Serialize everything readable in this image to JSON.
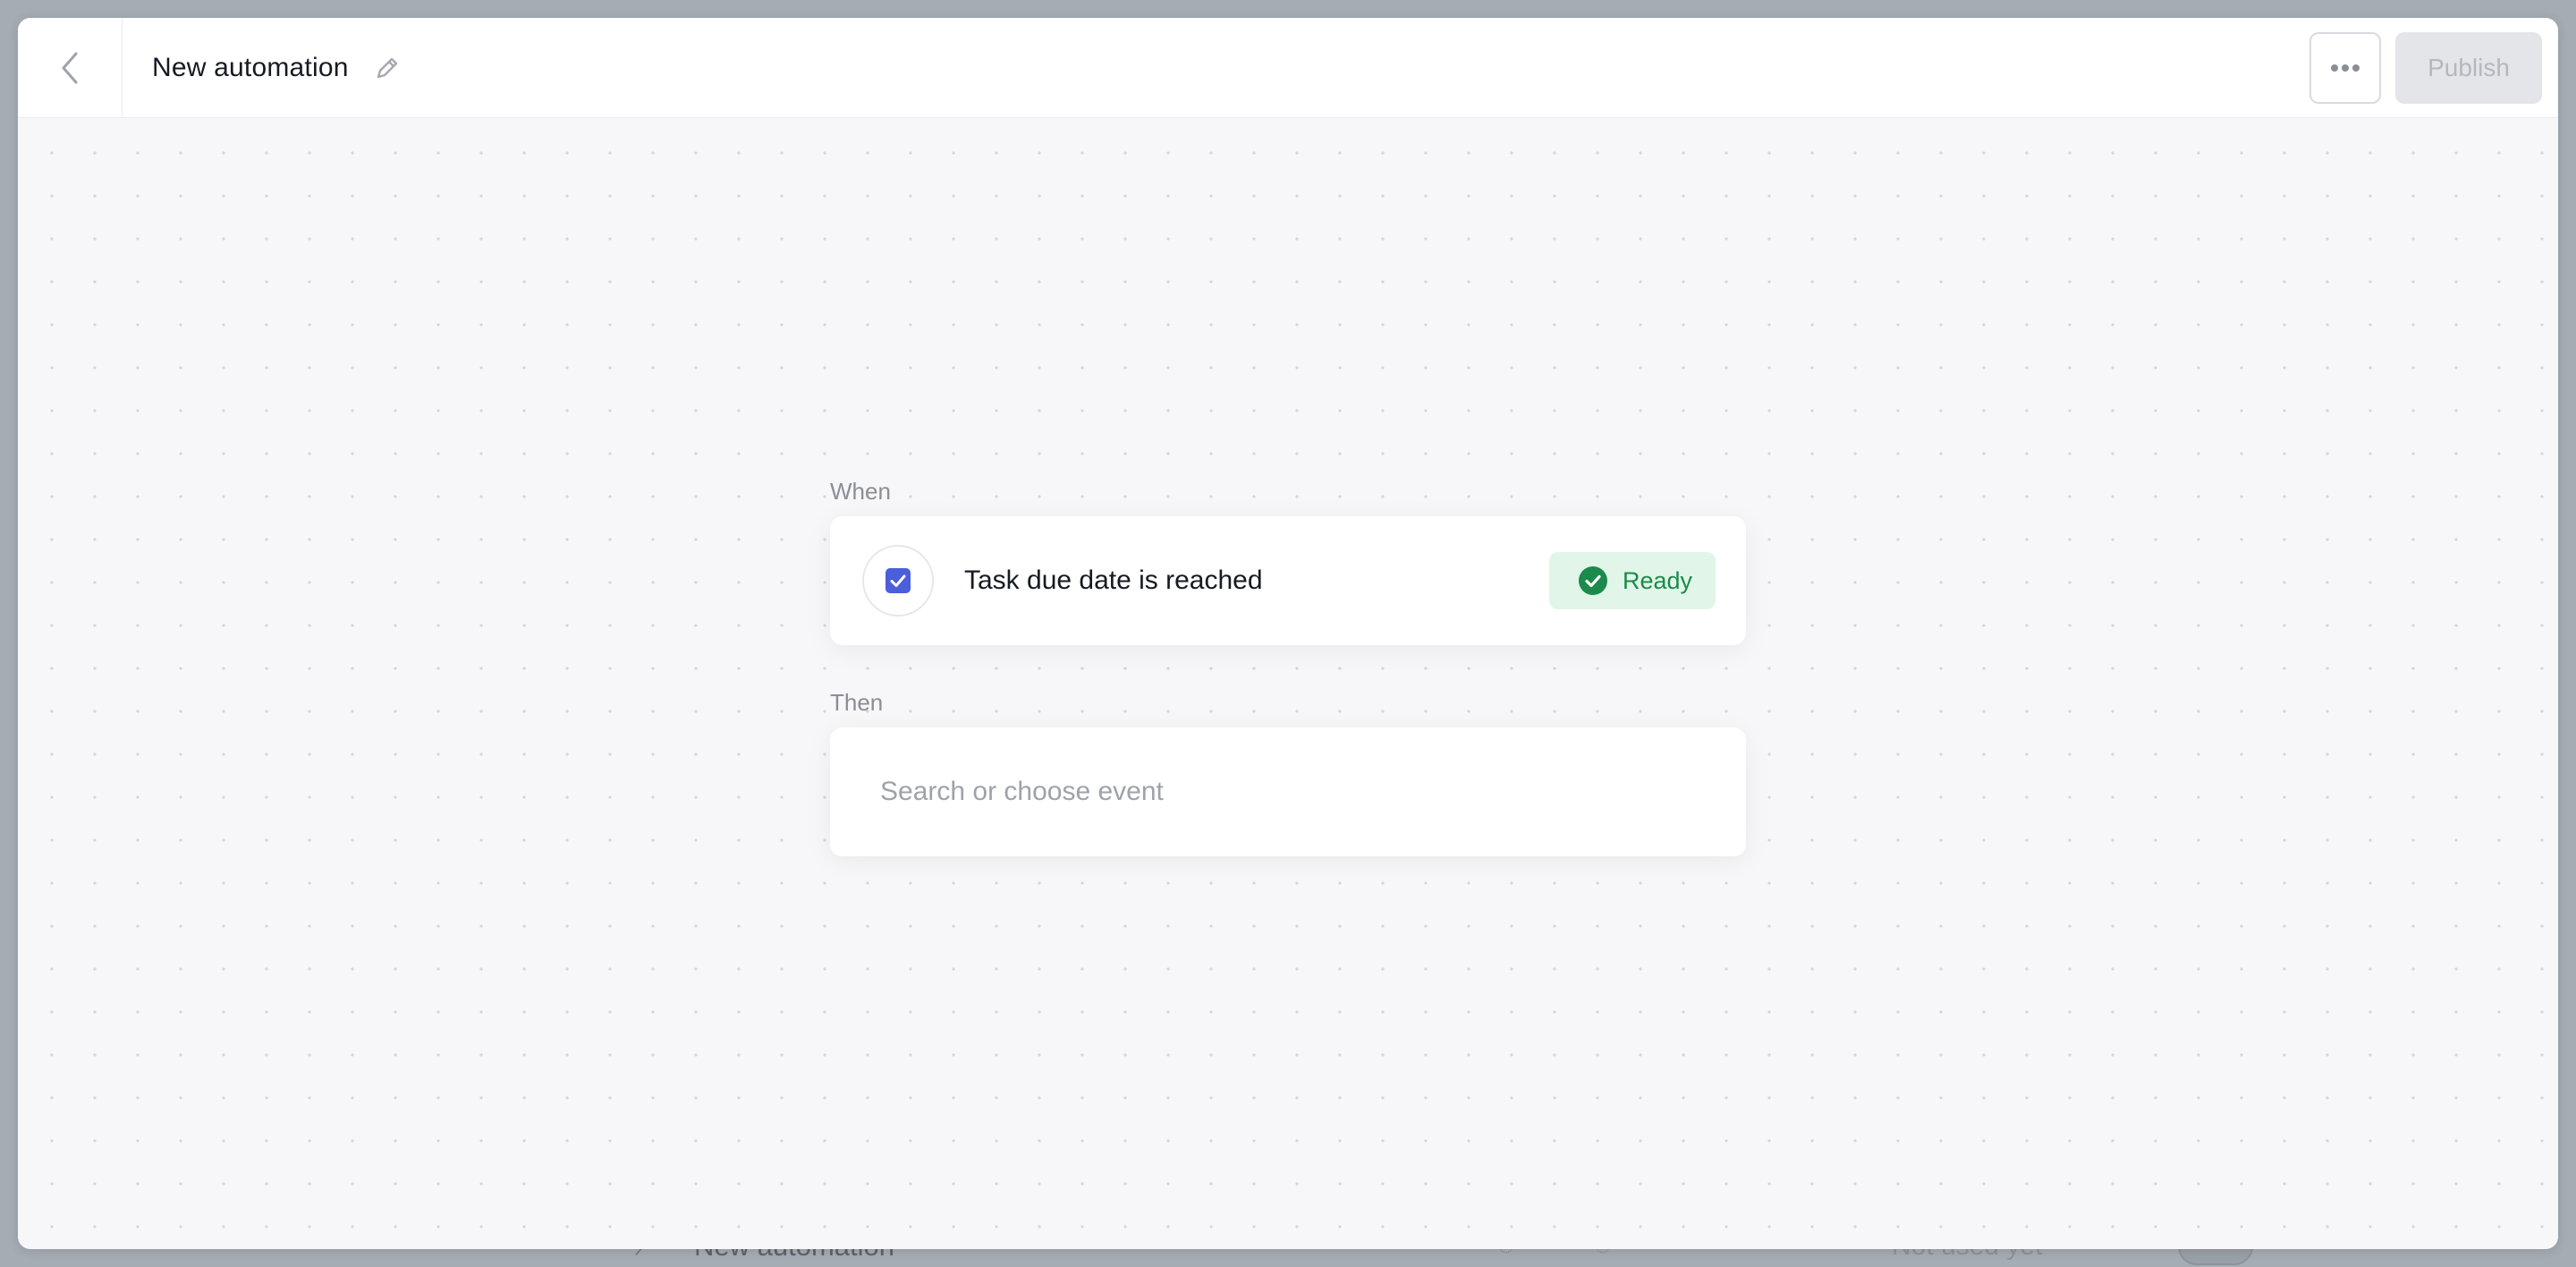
{
  "header": {
    "title": "New automation",
    "more_icon": "ellipsis-icon",
    "publish_label": "Publish"
  },
  "flow": {
    "when_label": "When",
    "trigger": {
      "label": "Task due date is reached",
      "icon": "checkbox-icon",
      "status": "Ready",
      "status_color": "#1b8a4a"
    },
    "then_label": "Then",
    "event_search": {
      "placeholder": "Search or choose event",
      "value": ""
    }
  },
  "backdrop": {
    "row_name": "New automation",
    "row_status": "Not used yet"
  },
  "colors": {
    "accent": "#4a5fd9",
    "ready_bg": "#e1f5e8",
    "ready_text": "#1b8a4a",
    "publish_disabled_bg": "#e4e5e8"
  }
}
